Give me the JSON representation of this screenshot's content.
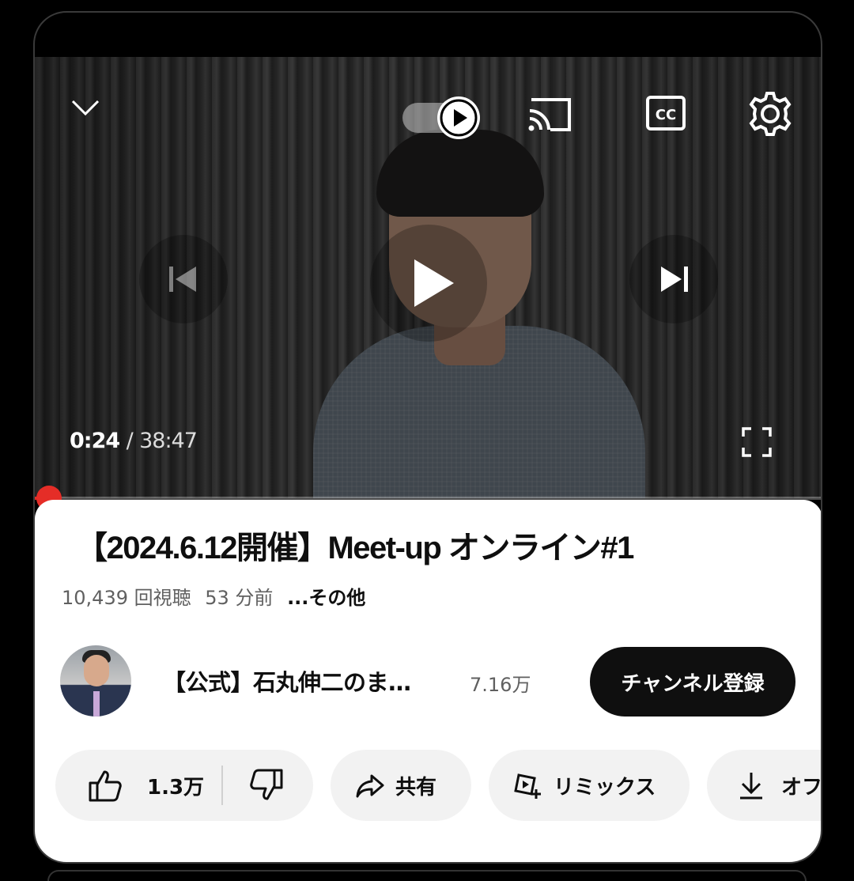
{
  "player": {
    "current_time": "0:24",
    "separator": "/",
    "duration": "38:47",
    "progress_fraction": 0.0103,
    "icons": {
      "collapse": "chevron-down-icon",
      "autoplay": "autoplay-toggle-icon",
      "cast": "cast-icon",
      "captions": "closed-captions-icon",
      "settings": "gear-icon",
      "previous": "skip-previous-icon",
      "play": "play-icon",
      "next": "skip-next-icon",
      "fullscreen": "fullscreen-icon"
    },
    "accent_color": "#e52d27"
  },
  "video": {
    "title": "【2024.6.12開催】Meet-up オンライン#1",
    "views": "10,439 回視聴",
    "age": "53 分前",
    "more": "...その他"
  },
  "channel": {
    "name": "【公式】石丸伸二のま…",
    "subscribers": "7.16万",
    "subscribe_label": "チャンネル登録"
  },
  "actions": {
    "like_count": "1.3万",
    "share_label": "共有",
    "remix_label": "リミックス",
    "download_label": "オフ"
  }
}
